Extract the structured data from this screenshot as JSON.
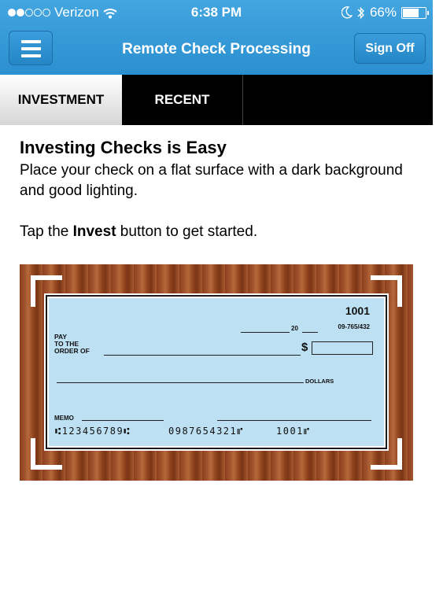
{
  "status_bar": {
    "carrier": "Verizon",
    "time": "6:38 PM",
    "battery": "66%"
  },
  "header": {
    "title": "Remote Check Processing",
    "sign_off_label": "Sign Off"
  },
  "tabs": [
    {
      "label": "INVESTMENT",
      "active": true
    },
    {
      "label": "RECENT",
      "active": false
    }
  ],
  "content": {
    "heading": "Investing Checks is Easy",
    "instructions": "Place your check on a flat surface with a dark background and good lighting.",
    "tap_prefix": "Tap the ",
    "tap_bold": "Invest",
    "tap_suffix": " button to get started."
  },
  "check_image": {
    "number": "1001",
    "routing": "09-765/432",
    "year_prefix": "20",
    "pay_to_line1": "PAY",
    "pay_to_line2": "TO THE",
    "pay_to_line3": "ORDER OF",
    "dollar_sign": "$",
    "dollars_label": "DOLLARS",
    "memo_label": "MEMO",
    "micr_routing": "⑆123456789⑆",
    "micr_account": "0987654321⑈",
    "micr_check": "1001⑈"
  },
  "colors": {
    "header_blue": "#2b8fd0",
    "tab_bar": "#000000",
    "check_blue": "#bde0f2",
    "wood": "#a0522d"
  }
}
